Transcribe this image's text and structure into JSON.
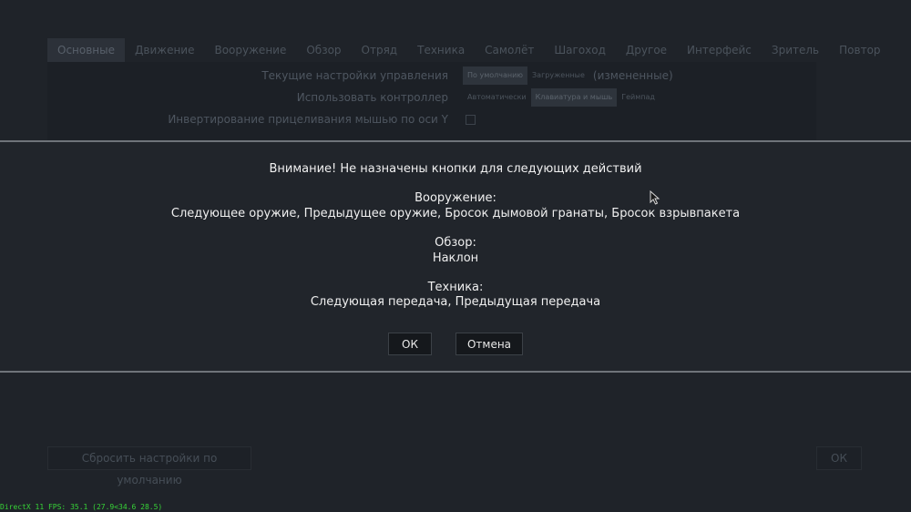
{
  "tabs": [
    "Основные",
    "Движение",
    "Вооружение",
    "Обзор",
    "Отряд",
    "Техника",
    "Самолёт",
    "Шагоход",
    "Другое",
    "Интерфейс",
    "Зритель",
    "Повтор"
  ],
  "settings": {
    "row1": {
      "label": "Текущие настройки управления",
      "options": [
        "По умолчанию",
        "Загруженные"
      ],
      "suffix": "(измененные)"
    },
    "row2": {
      "label": "Использовать контроллер",
      "options": [
        "Автоматически",
        "Клавиатура и мышь",
        "Геймпад"
      ]
    },
    "row3": {
      "label": "Инвертирование прицеливания мышью по оси Y"
    }
  },
  "bottom": {
    "reset_label": "Сбросить настройки по умолчанию",
    "ok_label": "ОК"
  },
  "fps_text": "DirectX 11 FPS: 35.1 (27.9<34.6 28.5)",
  "modal": {
    "title": "Внимание! Не назначены кнопки для следующих действий",
    "groups": [
      {
        "title": "Вооружение:",
        "items": "Следующее оружие, Предыдущее оружие, Бросок дымовой гранаты, Бросок взрывпакета"
      },
      {
        "title": "Обзор:",
        "items": "Наклон"
      },
      {
        "title": "Техника:",
        "items": "Следующая передача, Предыдущая передача"
      }
    ],
    "ok_label": "ОК",
    "cancel_label": "Отмена"
  }
}
